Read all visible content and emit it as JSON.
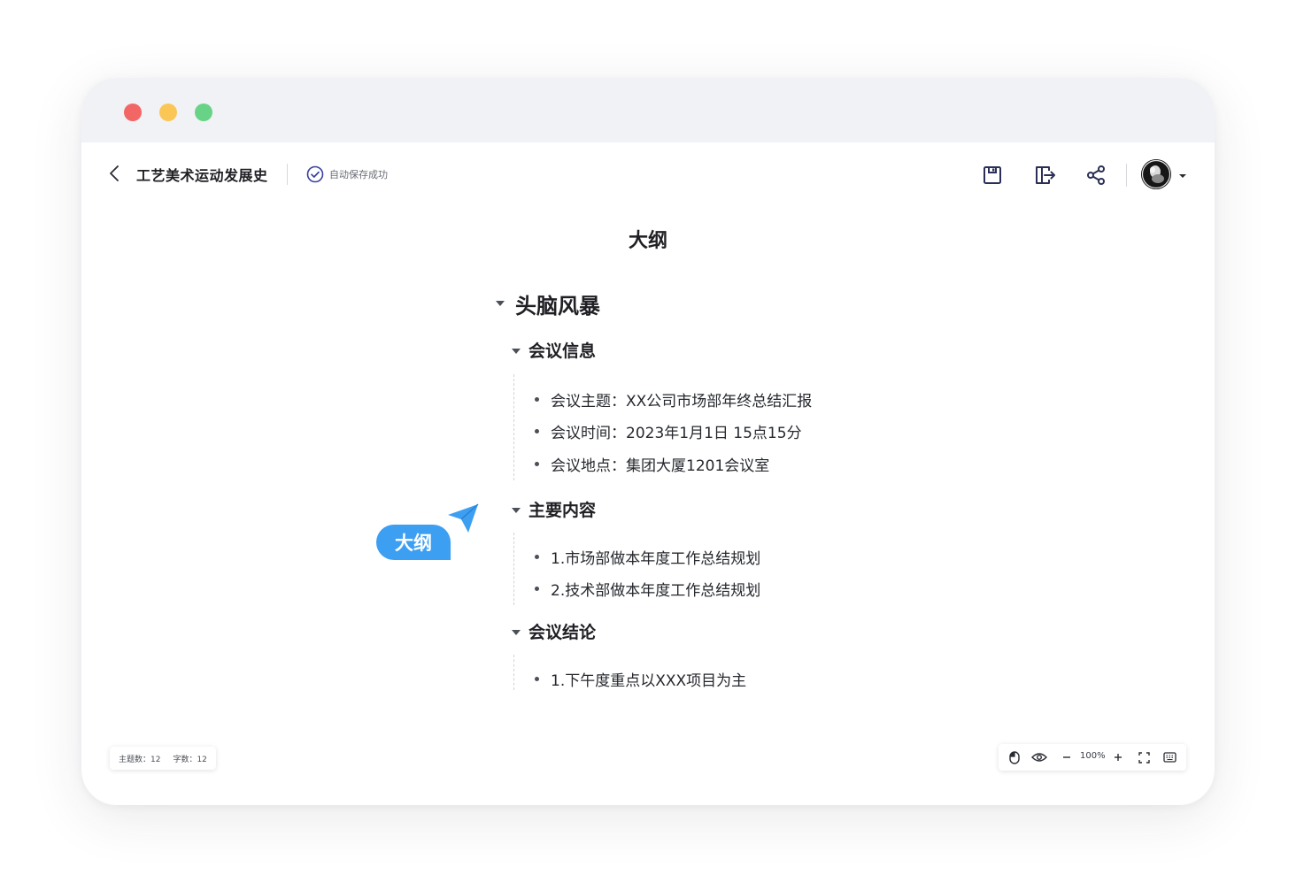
{
  "document": {
    "title": "工艺美术运动发展史",
    "save_status": "自动保存成功"
  },
  "outline": {
    "heading": "大纲",
    "root": "头脑风暴",
    "sections": [
      {
        "title": "会议信息",
        "items": [
          "会议主题：XX公司市场部年终总结汇报",
          "会议时间：2023年1月1日 15点15分",
          "会议地点：集团大厦1201会议室"
        ]
      },
      {
        "title": "主要内容",
        "items": [
          "1.市场部做本年度工作总结规划",
          "2.技术部做本年度工作总结规划"
        ]
      },
      {
        "title": "会议结论",
        "items": [
          "1.下午度重点以XXX项目为主"
        ]
      }
    ]
  },
  "overlay": {
    "bubble_label": "大纲"
  },
  "status": {
    "topics_label": "主题数：12",
    "words_label": "字数：12",
    "zoom": "100%"
  },
  "colors": {
    "accent": "#3d9ff2",
    "titlebar": "#f1f2f6",
    "traffic_red": "#f26666",
    "traffic_yellow": "#fac756",
    "traffic_green": "#68d386",
    "save_check": "#3a3fa0",
    "toolbar_icon": "#2b2f55"
  },
  "icons": [
    "back-arrow-icon",
    "check-circle-icon",
    "save-icon",
    "export-icon",
    "share-icon",
    "avatar",
    "caret-down-icon",
    "cursor-arrow-icon",
    "mouse-icon",
    "eye-icon",
    "zoom-out-icon",
    "zoom-in-icon",
    "fullscreen-icon",
    "keyboard-icon"
  ]
}
